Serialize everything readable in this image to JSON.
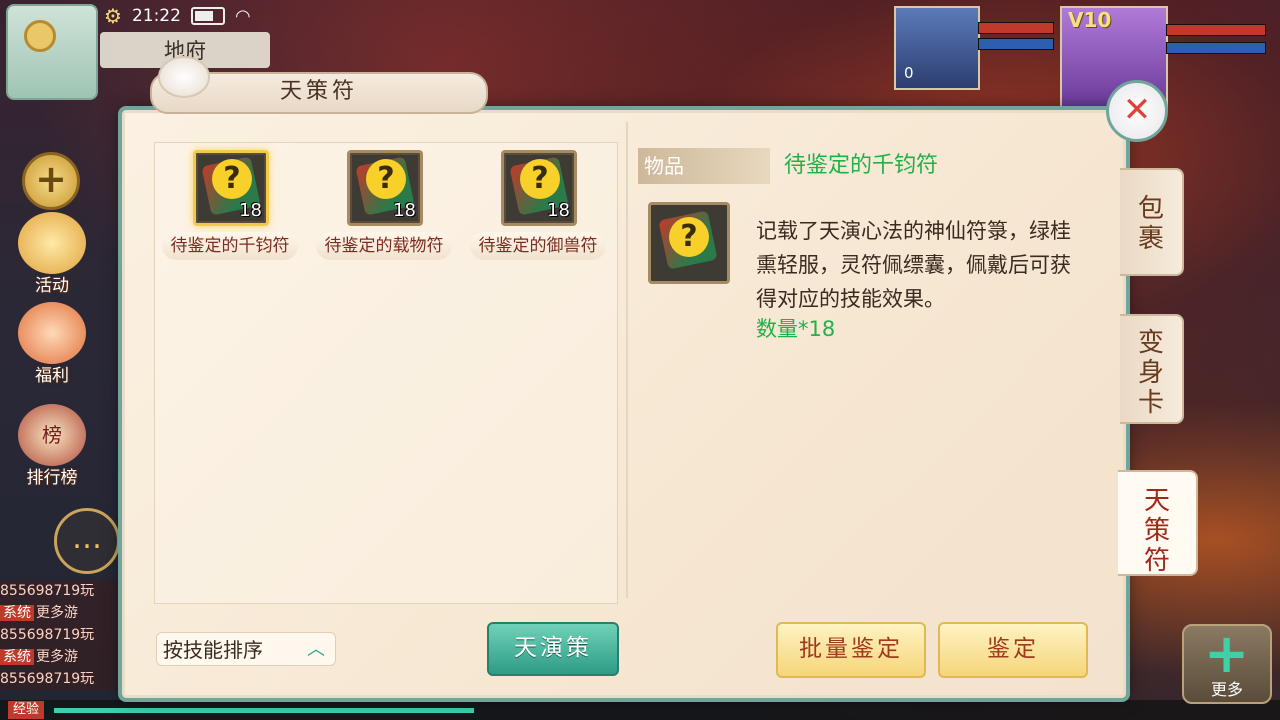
{
  "hud": {
    "time": "21:22",
    "zone": "地府",
    "side_buttons": [
      {
        "label": "活动",
        "icon": "gold-ingot-icon"
      },
      {
        "label": "福利",
        "icon": "gift-fox-icon"
      },
      {
        "label": "排行榜",
        "icon": "ranking-board-icon"
      }
    ],
    "ranking_badge": "榜",
    "chat_log": [
      {
        "tag": "",
        "text": "855698719玩"
      },
      {
        "tag": "系统",
        "text": "更多游"
      },
      {
        "tag": "",
        "text": "855698719玩"
      },
      {
        "tag": "系统",
        "text": "更多游"
      },
      {
        "tag": "",
        "text": "855698719玩"
      }
    ],
    "exp_label": "经验",
    "pet_level": "0",
    "vip": "V10",
    "more_label": "更多"
  },
  "panel": {
    "title": "天策符",
    "items": [
      {
        "name": "待鉴定的千钧符",
        "count": "18",
        "selected": true
      },
      {
        "name": "待鉴定的载物符",
        "count": "18",
        "selected": false
      },
      {
        "name": "待鉴定的御兽符",
        "count": "18",
        "selected": false
      }
    ],
    "detail": {
      "tag": "物品",
      "name": "待鉴定的千钧符",
      "description": "记载了天演心法的神仙符箓，绿桂熏轻服，灵符佩缥囊，佩戴后可获得对应的技能效果。",
      "quantity": "数量*18"
    },
    "sort_label": "按技能排序",
    "tianyan_label": "天演策",
    "batch_identify_label": "批量鉴定",
    "identify_label": "鉴定"
  },
  "tabs": [
    {
      "label": "包裹",
      "active": false
    },
    {
      "label": "变身卡",
      "active": false
    },
    {
      "label": "天策符",
      "active": true
    }
  ],
  "colors": {
    "accent_teal": "#2f9b86",
    "item_name_green": "#22b04a",
    "selected_gold": "#f3c94b"
  }
}
